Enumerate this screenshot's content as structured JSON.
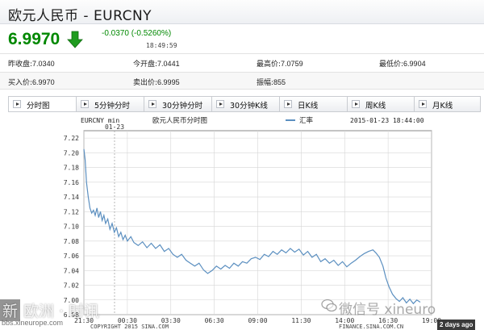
{
  "header": {
    "title": "欧元人民币 - EURCNY"
  },
  "quote": {
    "price": "6.9970",
    "change": "-0.0370 (-0.5260%)",
    "time": "18:49:59",
    "direction_icon": "arrow-down-icon",
    "down_color": "#008800"
  },
  "stats": {
    "row1": [
      {
        "label": "昨收盘:",
        "value": "7.0340"
      },
      {
        "label": "今开盘:",
        "value": "7.0441"
      },
      {
        "label": "最高价:",
        "value": "7.0759"
      },
      {
        "label": "最低价:",
        "value": "6.9904"
      }
    ],
    "row2": [
      {
        "label": "买入价:",
        "value": "6.9970"
      },
      {
        "label": "卖出价:",
        "value": "6.9995"
      },
      {
        "label": "振幅:",
        "value": "855"
      }
    ]
  },
  "tabs": [
    {
      "label": "分时图",
      "active": true
    },
    {
      "label": "5分钟分时",
      "active": false
    },
    {
      "label": "30分钟分时",
      "active": false
    },
    {
      "label": "30分钟K线",
      "active": false
    },
    {
      "label": "日K线",
      "active": false
    },
    {
      "label": "周K线",
      "active": false
    },
    {
      "label": "月K线",
      "active": false
    }
  ],
  "chart_header": {
    "code": "EURCNY min",
    "name": "欧元人民币分时图",
    "legend": "汇率",
    "datetime": "2015-01-23 18:44:00",
    "date_marker": "01-23",
    "copyright": "COPYRIGHT 2015 SINA.COM",
    "source": "FINANCE.SINA.COM.CN",
    "line_color": "#5b8fc0"
  },
  "chart_data": {
    "type": "line",
    "x_ticks": [
      "21:30",
      "00:30",
      "03:30",
      "06:30",
      "09:00",
      "11:30",
      "14:00",
      "16:30",
      "19:00"
    ],
    "y_ticks": [
      "7.22",
      "7.20",
      "7.18",
      "7.16",
      "7.14",
      "7.12",
      "7.10",
      "7.08",
      "7.06",
      "7.04",
      "7.02",
      "7.00",
      "6.98"
    ],
    "ylim": [
      6.98,
      7.23
    ],
    "x_index_range": [
      0,
      8
    ],
    "series": [
      {
        "name": "汇率",
        "points": [
          [
            0.0,
            7.205
          ],
          [
            0.03,
            7.19
          ],
          [
            0.06,
            7.16
          ],
          [
            0.1,
            7.14
          ],
          [
            0.14,
            7.125
          ],
          [
            0.18,
            7.118
          ],
          [
            0.22,
            7.122
          ],
          [
            0.26,
            7.115
          ],
          [
            0.3,
            7.125
          ],
          [
            0.34,
            7.112
          ],
          [
            0.38,
            7.12
          ],
          [
            0.42,
            7.108
          ],
          [
            0.46,
            7.115
          ],
          [
            0.5,
            7.104
          ],
          [
            0.55,
            7.11
          ],
          [
            0.6,
            7.096
          ],
          [
            0.65,
            7.104
          ],
          [
            0.7,
            7.092
          ],
          [
            0.75,
            7.098
          ],
          [
            0.8,
            7.086
          ],
          [
            0.85,
            7.092
          ],
          [
            0.9,
            7.082
          ],
          [
            0.95,
            7.088
          ],
          [
            1.0,
            7.08
          ],
          [
            1.08,
            7.086
          ],
          [
            1.15,
            7.078
          ],
          [
            1.25,
            7.074
          ],
          [
            1.35,
            7.079
          ],
          [
            1.45,
            7.071
          ],
          [
            1.55,
            7.077
          ],
          [
            1.65,
            7.07
          ],
          [
            1.75,
            7.075
          ],
          [
            1.85,
            7.066
          ],
          [
            1.95,
            7.07
          ],
          [
            2.05,
            7.062
          ],
          [
            2.15,
            7.058
          ],
          [
            2.25,
            7.062
          ],
          [
            2.35,
            7.054
          ],
          [
            2.45,
            7.05
          ],
          [
            2.55,
            7.046
          ],
          [
            2.65,
            7.05
          ],
          [
            2.75,
            7.041
          ],
          [
            2.85,
            7.036
          ],
          [
            2.95,
            7.04
          ],
          [
            3.05,
            7.046
          ],
          [
            3.15,
            7.042
          ],
          [
            3.25,
            7.047
          ],
          [
            3.35,
            7.043
          ],
          [
            3.45,
            7.05
          ],
          [
            3.55,
            7.046
          ],
          [
            3.65,
            7.052
          ],
          [
            3.75,
            7.05
          ],
          [
            3.85,
            7.056
          ],
          [
            3.95,
            7.058
          ],
          [
            4.05,
            7.055
          ],
          [
            4.15,
            7.062
          ],
          [
            4.25,
            7.059
          ],
          [
            4.35,
            7.066
          ],
          [
            4.45,
            7.062
          ],
          [
            4.55,
            7.068
          ],
          [
            4.65,
            7.064
          ],
          [
            4.75,
            7.07
          ],
          [
            4.85,
            7.065
          ],
          [
            4.95,
            7.069
          ],
          [
            5.05,
            7.061
          ],
          [
            5.15,
            7.066
          ],
          [
            5.25,
            7.058
          ],
          [
            5.35,
            7.062
          ],
          [
            5.45,
            7.052
          ],
          [
            5.55,
            7.056
          ],
          [
            5.65,
            7.05
          ],
          [
            5.75,
            7.054
          ],
          [
            5.85,
            7.047
          ],
          [
            5.95,
            7.052
          ],
          [
            6.05,
            7.045
          ],
          [
            6.15,
            7.05
          ],
          [
            6.25,
            7.054
          ],
          [
            6.35,
            7.059
          ],
          [
            6.45,
            7.063
          ],
          [
            6.55,
            7.066
          ],
          [
            6.65,
            7.068
          ],
          [
            6.72,
            7.064
          ],
          [
            6.8,
            7.058
          ],
          [
            6.88,
            7.046
          ],
          [
            6.95,
            7.03
          ],
          [
            7.02,
            7.018
          ],
          [
            7.1,
            7.008
          ],
          [
            7.18,
            7.002
          ],
          [
            7.26,
            6.998
          ],
          [
            7.34,
            7.003
          ],
          [
            7.42,
            6.996
          ],
          [
            7.5,
            7.001
          ],
          [
            7.58,
            6.995
          ],
          [
            7.66,
            7.0
          ],
          [
            7.74,
            6.997
          ]
        ]
      }
    ],
    "grid": true,
    "legend_position": "top-center"
  },
  "watermarks": {
    "left_main_box": "新",
    "left_main_text": "欧洲 · 时讯",
    "left_sub": "bbs.xineurope.com",
    "right_icon": "wechat-icon",
    "right_text": "微信号 xineuro",
    "badge": "2 days ago"
  }
}
